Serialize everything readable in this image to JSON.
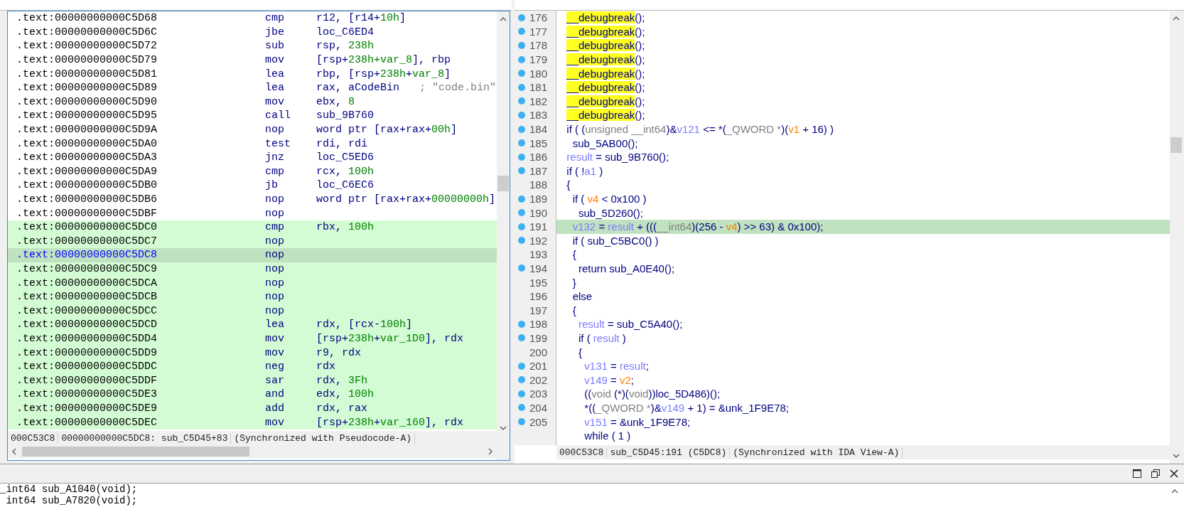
{
  "ida_view": {
    "rows": [
      {
        "address": ".text:00000000000C5D68",
        "mnemonic": "cmp",
        "operands": [
          {
            "kind": "plain",
            "text": "r12, [r14+"
          },
          {
            "kind": "num",
            "text": "10h"
          },
          {
            "kind": "plain",
            "text": "]"
          }
        ],
        "highlighted": false,
        "selected": false
      },
      {
        "address": ".text:00000000000C5D6C",
        "mnemonic": "jbe",
        "operands": [
          {
            "kind": "plain",
            "text": "loc_C6ED4"
          }
        ],
        "highlighted": false,
        "selected": false
      },
      {
        "address": ".text:00000000000C5D72",
        "mnemonic": "sub",
        "operands": [
          {
            "kind": "plain",
            "text": "rsp, "
          },
          {
            "kind": "num",
            "text": "238h"
          }
        ],
        "highlighted": false,
        "selected": false
      },
      {
        "address": ".text:00000000000C5D79",
        "mnemonic": "mov",
        "operands": [
          {
            "kind": "plain",
            "text": "[rsp+"
          },
          {
            "kind": "num",
            "text": "238h+var_8"
          },
          {
            "kind": "plain",
            "text": "], rbp"
          }
        ],
        "highlighted": false,
        "selected": false
      },
      {
        "address": ".text:00000000000C5D81",
        "mnemonic": "lea",
        "operands": [
          {
            "kind": "plain",
            "text": "rbp, [rsp+"
          },
          {
            "kind": "num",
            "text": "238h"
          },
          {
            "kind": "plain",
            "text": "+"
          },
          {
            "kind": "num",
            "text": "var_8"
          },
          {
            "kind": "plain",
            "text": "]"
          }
        ],
        "highlighted": false,
        "selected": false
      },
      {
        "address": ".text:00000000000C5D89",
        "mnemonic": "lea",
        "operands": [
          {
            "kind": "plain",
            "text": "rax, aCodeBin"
          }
        ],
        "comment": "; \"code.bin\"",
        "highlighted": false,
        "selected": false
      },
      {
        "address": ".text:00000000000C5D90",
        "mnemonic": "mov",
        "operands": [
          {
            "kind": "plain",
            "text": "ebx, "
          },
          {
            "kind": "num",
            "text": "8"
          }
        ],
        "highlighted": false,
        "selected": false
      },
      {
        "address": ".text:00000000000C5D95",
        "mnemonic": "call",
        "operands": [
          {
            "kind": "plain",
            "text": "sub_9B760"
          }
        ],
        "highlighted": false,
        "selected": false
      },
      {
        "address": ".text:00000000000C5D9A",
        "mnemonic": "nop",
        "operands": [
          {
            "kind": "plain",
            "text": "word ptr [rax+rax+"
          },
          {
            "kind": "num",
            "text": "00h"
          },
          {
            "kind": "plain",
            "text": "]"
          }
        ],
        "highlighted": false,
        "selected": false
      },
      {
        "address": ".text:00000000000C5DA0",
        "mnemonic": "test",
        "operands": [
          {
            "kind": "plain",
            "text": "rdi, rdi"
          }
        ],
        "highlighted": false,
        "selected": false
      },
      {
        "address": ".text:00000000000C5DA3",
        "mnemonic": "jnz",
        "operands": [
          {
            "kind": "plain",
            "text": "loc_C5ED6"
          }
        ],
        "highlighted": false,
        "selected": false
      },
      {
        "address": ".text:00000000000C5DA9",
        "mnemonic": "cmp",
        "operands": [
          {
            "kind": "plain",
            "text": "rcx, "
          },
          {
            "kind": "num",
            "text": "100h"
          }
        ],
        "highlighted": false,
        "selected": false
      },
      {
        "address": ".text:00000000000C5DB0",
        "mnemonic": "jb",
        "operands": [
          {
            "kind": "plain",
            "text": "loc_C6EC6"
          }
        ],
        "highlighted": false,
        "selected": false
      },
      {
        "address": ".text:00000000000C5DB6",
        "mnemonic": "nop",
        "operands": [
          {
            "kind": "plain",
            "text": "word ptr [rax+rax+"
          },
          {
            "kind": "num",
            "text": "00000000h"
          },
          {
            "kind": "plain",
            "text": "]"
          }
        ],
        "highlighted": false,
        "selected": false
      },
      {
        "address": ".text:00000000000C5DBF",
        "mnemonic": "nop",
        "operands": [],
        "highlighted": false,
        "selected": false
      },
      {
        "address": ".text:00000000000C5DC0",
        "mnemonic": "cmp",
        "operands": [
          {
            "kind": "plain",
            "text": "rbx, "
          },
          {
            "kind": "num",
            "text": "100h"
          }
        ],
        "highlighted": true,
        "selected": false
      },
      {
        "address": ".text:00000000000C5DC7",
        "mnemonic": "nop",
        "operands": [],
        "highlighted": true,
        "selected": false
      },
      {
        "address": ".text:00000000000C5DC8",
        "mnemonic": "nop",
        "operands": [],
        "highlighted": true,
        "selected": true
      },
      {
        "address": ".text:00000000000C5DC9",
        "mnemonic": "nop",
        "operands": [],
        "highlighted": true,
        "selected": false
      },
      {
        "address": ".text:00000000000C5DCA",
        "mnemonic": "nop",
        "operands": [],
        "highlighted": true,
        "selected": false
      },
      {
        "address": ".text:00000000000C5DCB",
        "mnemonic": "nop",
        "operands": [],
        "highlighted": true,
        "selected": false
      },
      {
        "address": ".text:00000000000C5DCC",
        "mnemonic": "nop",
        "operands": [],
        "highlighted": true,
        "selected": false
      },
      {
        "address": ".text:00000000000C5DCD",
        "mnemonic": "lea",
        "operands": [
          {
            "kind": "plain",
            "text": "rdx, [rcx-"
          },
          {
            "kind": "num",
            "text": "100h"
          },
          {
            "kind": "plain",
            "text": "]"
          }
        ],
        "highlighted": true,
        "selected": false
      },
      {
        "address": ".text:00000000000C5DD4",
        "mnemonic": "mov",
        "operands": [
          {
            "kind": "plain",
            "text": "[rsp+"
          },
          {
            "kind": "num",
            "text": "238h"
          },
          {
            "kind": "plain",
            "text": "+"
          },
          {
            "kind": "num",
            "text": "var_1D0"
          },
          {
            "kind": "plain",
            "text": "], rdx"
          }
        ],
        "highlighted": true,
        "selected": false
      },
      {
        "address": ".text:00000000000C5DD9",
        "mnemonic": "mov",
        "operands": [
          {
            "kind": "plain",
            "text": "r9, rdx"
          }
        ],
        "highlighted": true,
        "selected": false
      },
      {
        "address": ".text:00000000000C5DDC",
        "mnemonic": "neg",
        "operands": [
          {
            "kind": "plain",
            "text": "rdx"
          }
        ],
        "highlighted": true,
        "selected": false
      },
      {
        "address": ".text:00000000000C5DDF",
        "mnemonic": "sar",
        "operands": [
          {
            "kind": "plain",
            "text": "rdx, "
          },
          {
            "kind": "num",
            "text": "3Fh"
          }
        ],
        "highlighted": true,
        "selected": false
      },
      {
        "address": ".text:00000000000C5DE3",
        "mnemonic": "and",
        "operands": [
          {
            "kind": "plain",
            "text": "edx, "
          },
          {
            "kind": "num",
            "text": "100h"
          }
        ],
        "highlighted": true,
        "selected": false
      },
      {
        "address": ".text:00000000000C5DE9",
        "mnemonic": "add",
        "operands": [
          {
            "kind": "plain",
            "text": "rdx, rax"
          }
        ],
        "highlighted": true,
        "selected": false
      },
      {
        "address": ".text:00000000000C5DEC",
        "mnemonic": "mov",
        "operands": [
          {
            "kind": "plain",
            "text": "[rsp+"
          },
          {
            "kind": "num",
            "text": "238h"
          },
          {
            "kind": "plain",
            "text": "+"
          },
          {
            "kind": "num",
            "text": "var_160"
          },
          {
            "kind": "plain",
            "text": "], rdx"
          }
        ],
        "highlighted": true,
        "selected": false
      }
    ],
    "status_bar": [
      "000C53C8",
      "00000000000C5DC8: sub_C5D45+83",
      "(Synchronized with Pseudocode-A)"
    ]
  },
  "pseudocode": {
    "lines": [
      {
        "number": "176",
        "dot": true,
        "selected": false,
        "tokens": [
          {
            "kind": "mark",
            "text": "  __debugbreak"
          },
          {
            "kind": "plain",
            "text": "();"
          }
        ]
      },
      {
        "number": "177",
        "dot": true,
        "selected": false,
        "tokens": [
          {
            "kind": "mark",
            "text": "  __debugbreak"
          },
          {
            "kind": "plain",
            "text": "();"
          }
        ]
      },
      {
        "number": "178",
        "dot": true,
        "selected": false,
        "tokens": [
          {
            "kind": "mark",
            "text": "  __debugbreak"
          },
          {
            "kind": "plain",
            "text": "();"
          }
        ]
      },
      {
        "number": "179",
        "dot": true,
        "selected": false,
        "tokens": [
          {
            "kind": "mark",
            "text": "  __debugbreak"
          },
          {
            "kind": "plain",
            "text": "();"
          }
        ]
      },
      {
        "number": "180",
        "dot": true,
        "selected": false,
        "tokens": [
          {
            "kind": "mark",
            "text": "  __debugbreak"
          },
          {
            "kind": "plain",
            "text": "();"
          }
        ]
      },
      {
        "number": "181",
        "dot": true,
        "selected": false,
        "tokens": [
          {
            "kind": "mark",
            "text": "  __debugbreak"
          },
          {
            "kind": "plain",
            "text": "();"
          }
        ]
      },
      {
        "number": "182",
        "dot": true,
        "selected": false,
        "tokens": [
          {
            "kind": "mark",
            "text": "  __debugbreak"
          },
          {
            "kind": "plain",
            "text": "();"
          }
        ]
      },
      {
        "number": "183",
        "dot": true,
        "selected": false,
        "tokens": [
          {
            "kind": "mark",
            "text": "  __debugbreak"
          },
          {
            "kind": "plain",
            "text": "();"
          }
        ]
      },
      {
        "number": "184",
        "dot": true,
        "selected": false,
        "tokens": [
          {
            "kind": "plain",
            "text": "  if ( ("
          },
          {
            "kind": "type",
            "text": "unsigned __int64"
          },
          {
            "kind": "plain",
            "text": ")&"
          },
          {
            "kind": "var",
            "text": "v121"
          },
          {
            "kind": "plain",
            "text": " <= *("
          },
          {
            "kind": "type",
            "text": "_QWORD *"
          },
          {
            "kind": "plain",
            "text": ")("
          },
          {
            "kind": "arg",
            "text": "v1"
          },
          {
            "kind": "plain",
            "text": " + 16) )"
          }
        ]
      },
      {
        "number": "185",
        "dot": true,
        "selected": false,
        "tokens": [
          {
            "kind": "plain",
            "text": "    sub_5AB00();"
          }
        ]
      },
      {
        "number": "186",
        "dot": true,
        "selected": false,
        "tokens": [
          {
            "kind": "var",
            "text": "  result"
          },
          {
            "kind": "plain",
            "text": " = sub_9B760();"
          }
        ]
      },
      {
        "number": "187",
        "dot": true,
        "selected": false,
        "tokens": [
          {
            "kind": "plain",
            "text": "  if ( !"
          },
          {
            "kind": "var",
            "text": "a1"
          },
          {
            "kind": "plain",
            "text": " )"
          }
        ]
      },
      {
        "number": "188",
        "dot": false,
        "selected": false,
        "tokens": [
          {
            "kind": "plain",
            "text": "  {"
          }
        ]
      },
      {
        "number": "189",
        "dot": true,
        "selected": false,
        "tokens": [
          {
            "kind": "plain",
            "text": "    if ( "
          },
          {
            "kind": "arg",
            "text": "v4"
          },
          {
            "kind": "plain",
            "text": " < 0x100 )"
          }
        ]
      },
      {
        "number": "190",
        "dot": true,
        "selected": false,
        "tokens": [
          {
            "kind": "plain",
            "text": "      sub_5D260();"
          }
        ]
      },
      {
        "number": "191",
        "dot": true,
        "selected": true,
        "tokens": [
          {
            "kind": "var",
            "text": "    v132"
          },
          {
            "kind": "plain",
            "text": " = "
          },
          {
            "kind": "var",
            "text": "result"
          },
          {
            "kind": "plain",
            "text": " + ((("
          },
          {
            "kind": "type",
            "text": "__int64"
          },
          {
            "kind": "plain",
            "text": ")(256 - "
          },
          {
            "kind": "arg",
            "text": "v4"
          },
          {
            "kind": "plain",
            "text": ") >> 63) & 0x100);"
          }
        ]
      },
      {
        "number": "192",
        "dot": true,
        "selected": false,
        "tokens": [
          {
            "kind": "plain",
            "text": "    if ( sub_C5BC0() )"
          }
        ]
      },
      {
        "number": "193",
        "dot": false,
        "selected": false,
        "tokens": [
          {
            "kind": "plain",
            "text": "    {"
          }
        ]
      },
      {
        "number": "194",
        "dot": true,
        "selected": false,
        "tokens": [
          {
            "kind": "plain",
            "text": "      return sub_A0E40();"
          }
        ]
      },
      {
        "number": "195",
        "dot": false,
        "selected": false,
        "tokens": [
          {
            "kind": "plain",
            "text": "    }"
          }
        ]
      },
      {
        "number": "196",
        "dot": false,
        "selected": false,
        "tokens": [
          {
            "kind": "plain",
            "text": "    else"
          }
        ]
      },
      {
        "number": "197",
        "dot": false,
        "selected": false,
        "tokens": [
          {
            "kind": "plain",
            "text": "    {"
          }
        ]
      },
      {
        "number": "198",
        "dot": true,
        "selected": false,
        "tokens": [
          {
            "kind": "var",
            "text": "      result"
          },
          {
            "kind": "plain",
            "text": " = sub_C5A40();"
          }
        ]
      },
      {
        "number": "199",
        "dot": true,
        "selected": false,
        "tokens": [
          {
            "kind": "plain",
            "text": "      if ( "
          },
          {
            "kind": "var",
            "text": "result"
          },
          {
            "kind": "plain",
            "text": " )"
          }
        ]
      },
      {
        "number": "200",
        "dot": false,
        "selected": false,
        "tokens": [
          {
            "kind": "plain",
            "text": "      {"
          }
        ]
      },
      {
        "number": "201",
        "dot": true,
        "selected": false,
        "tokens": [
          {
            "kind": "var",
            "text": "        v131"
          },
          {
            "kind": "plain",
            "text": " = "
          },
          {
            "kind": "var",
            "text": "result"
          },
          {
            "kind": "plain",
            "text": ";"
          }
        ]
      },
      {
        "number": "202",
        "dot": true,
        "selected": false,
        "tokens": [
          {
            "kind": "var",
            "text": "        v149"
          },
          {
            "kind": "plain",
            "text": " = "
          },
          {
            "kind": "arg",
            "text": "v2"
          },
          {
            "kind": "plain",
            "text": ";"
          }
        ]
      },
      {
        "number": "203",
        "dot": true,
        "selected": false,
        "tokens": [
          {
            "kind": "plain",
            "text": "        (("
          },
          {
            "kind": "type",
            "text": "void"
          },
          {
            "kind": "plain",
            "text": " (*)("
          },
          {
            "kind": "type",
            "text": "void"
          },
          {
            "kind": "plain",
            "text": "))loc_5D486)();"
          }
        ]
      },
      {
        "number": "204",
        "dot": true,
        "selected": false,
        "tokens": [
          {
            "kind": "plain",
            "text": "        *(("
          },
          {
            "kind": "type",
            "text": "_QWORD *"
          },
          {
            "kind": "plain",
            "text": ")&"
          },
          {
            "kind": "var",
            "text": "v149"
          },
          {
            "kind": "plain",
            "text": " + 1) = &unk_1F9E78;"
          }
        ]
      },
      {
        "number": "205",
        "dot": true,
        "selected": false,
        "tokens": [
          {
            "kind": "var",
            "text": "        v151"
          },
          {
            "kind": "plain",
            "text": " = &unk_1F9E78;"
          }
        ]
      },
      {
        "dot": false,
        "selected": false,
        "tokens": [
          {
            "kind": "plain",
            "text": "        while ( 1 )"
          }
        ]
      }
    ],
    "status_bar": [
      "000C53C8",
      "sub_C5D45:191 (C5DC8)",
      "(Synchronized with IDA View-A)"
    ]
  },
  "bottom_panel": {
    "lines": [
      "_int64 sub_A1040(void);",
      " int64 sub_A7820(void);"
    ]
  }
}
